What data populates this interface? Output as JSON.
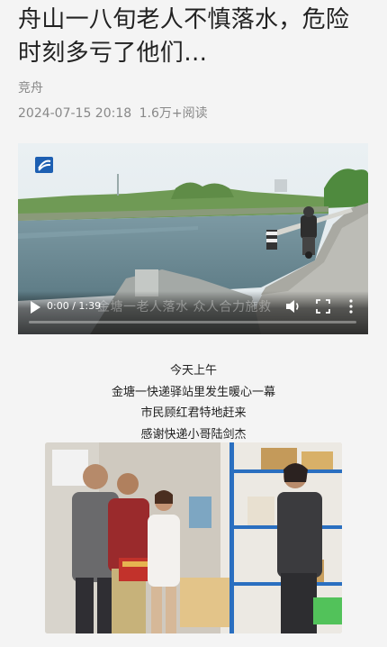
{
  "article": {
    "title": "舟山一八旬老人不慎落水，危险时刻多亏了他们…",
    "source": "竞舟",
    "date": "2024-07-15 20:18",
    "reads": "1.6万+阅读"
  },
  "video": {
    "current_time": "0:00 / 1:39",
    "subtitle_overlay": "金塘一老人落水 众人合力施救",
    "progress": 0.0,
    "icons": {
      "play": "play-icon",
      "volume": "volume-icon",
      "fullscreen": "fullscreen-icon",
      "more": "more-vertical-icon",
      "logo": "station-logo-icon"
    }
  },
  "captions": [
    "今天上午",
    "金塘一快递驿站里发生暖心一幕",
    "市民顾红君特地赶来",
    "感谢快递小哥陆剑杰"
  ],
  "colors": {
    "title": "#222222",
    "meta": "#888888",
    "background": "#f4f4f4"
  }
}
